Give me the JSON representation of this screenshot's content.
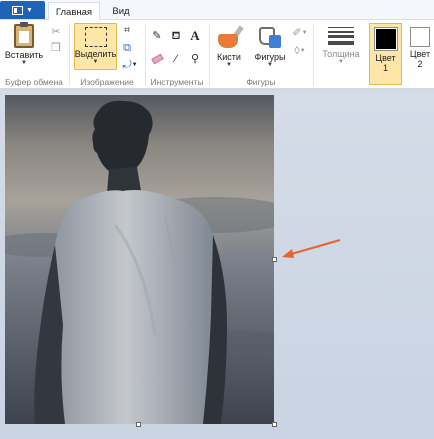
{
  "tabs": {
    "file_icon": "paint-menu-icon",
    "home": "Главная",
    "view": "Вид"
  },
  "ribbon": {
    "clipboard": {
      "paste_label": "Вставить",
      "group_label": "Буфер обмена"
    },
    "image": {
      "select_label": "Выделить",
      "group_label": "Изображение"
    },
    "tools": {
      "group_label": "Инструменты"
    },
    "shapes": {
      "brushes_label": "Кисти",
      "shapes_label": "Фигуры",
      "group_label": "Фигуры"
    },
    "thickness_label": "Толщина",
    "colors": {
      "color1_label_a": "Цвет",
      "color1_label_b": "1",
      "color1_value": "#000000",
      "color2_label_a": "Цвет",
      "color2_label_b": "2",
      "color2_value": "#ffffff"
    }
  },
  "canvas": {
    "image_subject": "photo-man-back-view",
    "annotation_color": "#e8632d",
    "annotation_target": "resize-handle-right"
  }
}
